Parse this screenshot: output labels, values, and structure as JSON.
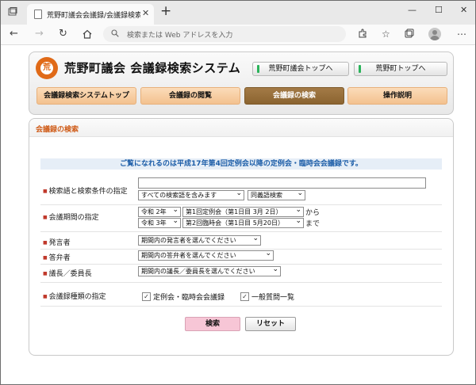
{
  "browser": {
    "tab_title": "荒野町議会会議録/会議録検索システム",
    "tab_close": "✕",
    "new_tab": "+",
    "minimize": "—",
    "maximize": "☐",
    "close": "✕",
    "address_placeholder": "検索または Web アドレスを入力"
  },
  "header": {
    "logo_char": "荒",
    "title": "荒野町議会 会議録検索システム",
    "link_council_top": "荒野町議会トップへ",
    "link_town_top": "荒野町トップへ"
  },
  "nav": {
    "tabs": [
      {
        "label": "会議録検索システムトップ"
      },
      {
        "label": "会議録の閲覧"
      },
      {
        "label": "会議録の検索"
      },
      {
        "label": "操作説明"
      }
    ]
  },
  "search": {
    "box_title": "会議録の検索",
    "notice": "ご覧になれるのは平成17年第4回定例会以降の定例会・臨時会会議録です。",
    "keyword": {
      "label": "検索語と検索条件の指定",
      "value": "",
      "condition": "すべての検索語を含みます",
      "synonym": "同義語検索"
    },
    "period": {
      "label": "会議期間の指定",
      "from_year": "令和 2年",
      "from_meeting": "第1回定例会（第1日目 3月 2日）",
      "from_suffix": "から",
      "to_year": "令和 3年",
      "to_meeting": "第2回臨時会（第1日目 5月20日）",
      "to_suffix": "まで"
    },
    "speaker": {
      "label": "発言者",
      "value": "期間内の発言者を選んでください"
    },
    "answerer": {
      "label": "答弁者",
      "value": "期間内の答弁者を選んでください"
    },
    "chair": {
      "label": "議長／委員長",
      "value": "期間内の議長／委員長を選んでください"
    },
    "kind": {
      "label": "会議録種類の指定",
      "options": [
        {
          "label": "定例会・臨時会会議録",
          "checked": true
        },
        {
          "label": "一般質問一覧",
          "checked": true
        }
      ]
    },
    "search_button": "検索",
    "reset_button": "リセット"
  }
}
